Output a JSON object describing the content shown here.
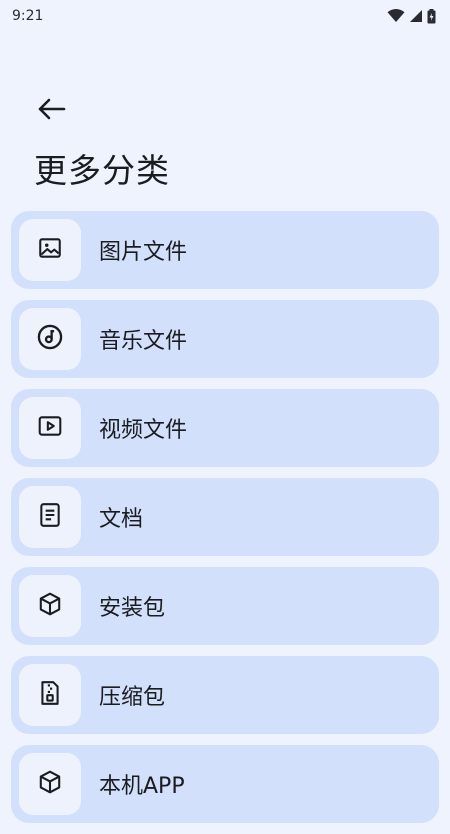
{
  "status_bar": {
    "time": "9:21",
    "icons": [
      "wifi-icon",
      "signal-icon",
      "battery-icon"
    ]
  },
  "header": {
    "back_icon": "arrow-left-icon",
    "title": "更多分类"
  },
  "categories": [
    {
      "label": "图片文件",
      "icon": "image-icon"
    },
    {
      "label": "音乐文件",
      "icon": "music-disc-icon"
    },
    {
      "label": "视频文件",
      "icon": "video-icon"
    },
    {
      "label": "文档",
      "icon": "document-icon"
    },
    {
      "label": "安装包",
      "icon": "package-icon"
    },
    {
      "label": "压缩包",
      "icon": "archive-icon"
    },
    {
      "label": "本机APP",
      "icon": "app-cube-icon"
    }
  ],
  "colors": {
    "background": "#eef3fd",
    "card": "#d2e0fb",
    "icon_box": "#edf2fc",
    "text": "#1b1c20"
  }
}
